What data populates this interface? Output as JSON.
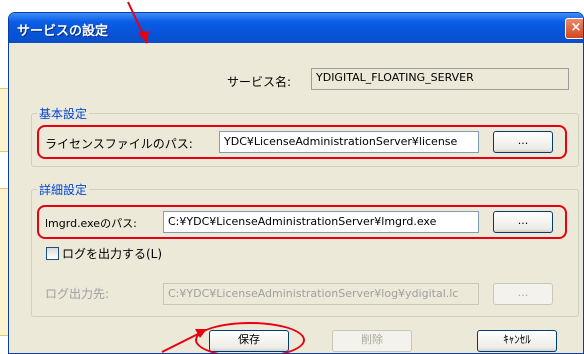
{
  "window": {
    "title": "サービスの設定",
    "close_glyph": "×"
  },
  "service": {
    "label": "サービス名:",
    "value": "YDIGITAL_FLOATING_SERVER"
  },
  "basic_group": {
    "title": "基本設定",
    "license_label": "ライセンスファイルのパス:",
    "license_value": "YDC¥LicenseAdministrationServer¥license",
    "browse_label": "..."
  },
  "detail_group": {
    "title": "詳細設定",
    "lmgrd_label": "lmgrd.exeのパス:",
    "lmgrd_value": "C:¥YDC¥LicenseAdministrationServer¥lmgrd.exe",
    "browse_label": "...",
    "log_checkbox_label": "ログを出力する(L)",
    "log_checked": false,
    "log_dest_label": "ログ出力先:",
    "log_dest_value": "C:¥YDC¥LicenseAdministrationServer¥log¥ydigital.lc",
    "log_browse_label": "..."
  },
  "buttons": {
    "save": "保存",
    "delete": "削除",
    "cancel": "ｷｬﾝｾﾙ"
  },
  "colors": {
    "highlight": "#e60012",
    "callout": "#fdf3cf",
    "titlebar": "#0a5ce6"
  }
}
